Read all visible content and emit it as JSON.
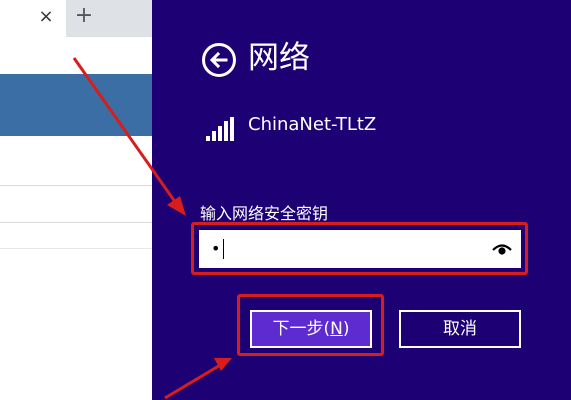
{
  "browser": {
    "tab_close_glyph": "×",
    "new_tab_glyph": "+"
  },
  "flyout": {
    "title": "网络",
    "ssid": "ChinaNet-TLtZ",
    "key_label": "输入网络安全密钥",
    "password_mask": "•",
    "next_button": {
      "text": "下一步(",
      "mnemonic": "N",
      "suffix": ")"
    },
    "cancel_button": "取消",
    "icons": [
      "back-arrow-icon",
      "wifi-signal-icon",
      "eye-icon"
    ]
  },
  "colors": {
    "flyout_bg": "#1d0073",
    "primary_button": "#5e2bd1",
    "annotation_red": "#d81d1d",
    "browser_header": "#3a6ea5"
  }
}
